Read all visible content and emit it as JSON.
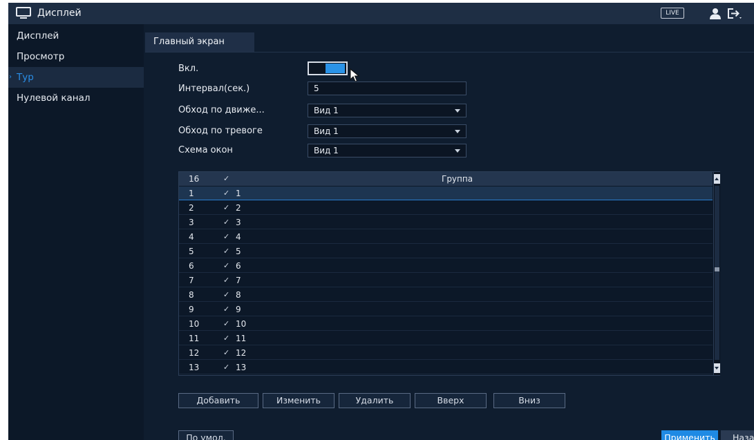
{
  "header": {
    "title": "Дисплей",
    "live_label": "LIVE",
    "icons": [
      "monitor-icon",
      "user-icon",
      "logout-icon"
    ]
  },
  "sidebar": {
    "items": [
      {
        "label": "Дисплей",
        "active": false
      },
      {
        "label": "Просмотр",
        "active": false
      },
      {
        "label": "Тур",
        "active": true
      },
      {
        "label": "Нулевой канал",
        "active": false
      }
    ],
    "active_indicator": "›"
  },
  "tabs": [
    {
      "label": "Главный экран",
      "active": true
    }
  ],
  "form": {
    "enable_label": "Вкл.",
    "enable_on": true,
    "interval_label": "Интервал(сек.)",
    "interval_value": "5",
    "motion_label": "Обход по движе...",
    "motion_value": "Вид 1",
    "alarm_label": "Обход по тревоге",
    "alarm_value": "Вид 1",
    "layout_label": "Схема окон",
    "layout_value": "Вид 1"
  },
  "table": {
    "header": {
      "count": "16",
      "check": "✓",
      "group": "Группа"
    },
    "rows": [
      {
        "num": "1",
        "check": "✓",
        "group": "1",
        "selected": true
      },
      {
        "num": "2",
        "check": "✓",
        "group": "2"
      },
      {
        "num": "3",
        "check": "✓",
        "group": "3"
      },
      {
        "num": "4",
        "check": "✓",
        "group": "4"
      },
      {
        "num": "5",
        "check": "✓",
        "group": "5"
      },
      {
        "num": "6",
        "check": "✓",
        "group": "6"
      },
      {
        "num": "7",
        "check": "✓",
        "group": "7"
      },
      {
        "num": "8",
        "check": "✓",
        "group": "8"
      },
      {
        "num": "9",
        "check": "✓",
        "group": "9"
      },
      {
        "num": "10",
        "check": "✓",
        "group": "10"
      },
      {
        "num": "11",
        "check": "✓",
        "group": "11"
      },
      {
        "num": "12",
        "check": "✓",
        "group": "12"
      },
      {
        "num": "13",
        "check": "✓",
        "group": "13"
      }
    ]
  },
  "actions": {
    "add": "Добавить",
    "edit": "Изменить",
    "delete": "Удалить",
    "up": "Вверх",
    "down": "Вниз"
  },
  "footer": {
    "default": "По умол.",
    "apply": "Применить",
    "back": "Назад"
  },
  "colors": {
    "background": "#0f1d2f",
    "accent": "#2a8ee6",
    "header_bar": "#1e2e44"
  }
}
